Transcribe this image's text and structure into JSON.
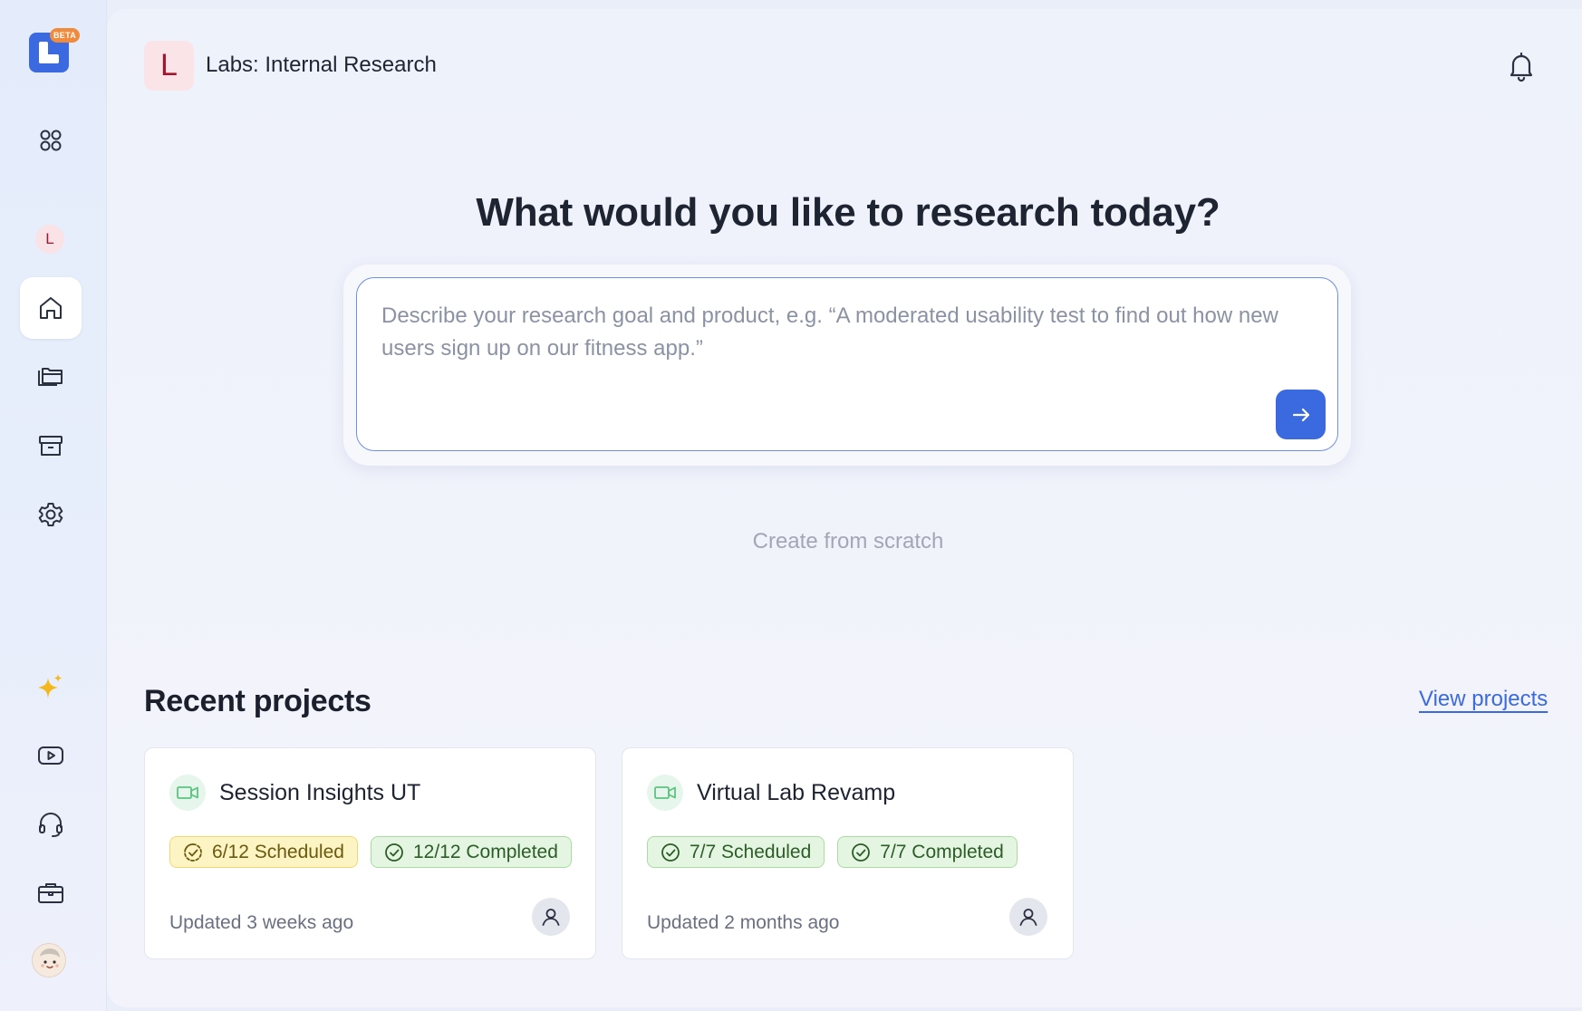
{
  "sidebar": {
    "logo_badge": "BETA",
    "workspace_initial": "L",
    "icons": {
      "apps": "apps-grid-icon",
      "home": "home-icon",
      "projects": "folders-icon",
      "archive": "archive-icon",
      "settings": "gear-icon",
      "ai": "sparkles-icon",
      "tutorials": "play-video-icon",
      "support": "headset-icon",
      "marketplace": "briefcase-icon"
    },
    "active_item": "home"
  },
  "header": {
    "workspace_initial": "L",
    "workspace_name": "Labs: Internal Research"
  },
  "hero": {
    "headline": "What would you like to research today?",
    "prompt_placeholder": "Describe your research goal and product, e.g. “A moderated usability test to find out how new users sign up on our fitness app.”",
    "create_from_scratch": "Create from scratch"
  },
  "recent": {
    "title": "Recent projects",
    "view_all": "View projects",
    "projects": [
      {
        "name": "Session Insights UT",
        "scheduled": "6/12 Scheduled",
        "completed": "12/12 Completed",
        "updated": "Updated 3 weeks ago",
        "scheduled_state": "partial"
      },
      {
        "name": "Virtual Lab Revamp",
        "scheduled": "7/7 Scheduled",
        "completed": "7/7 Completed",
        "updated": "Updated 2 months ago",
        "scheduled_state": "complete"
      }
    ]
  },
  "colors": {
    "accent": "#3b6ae0",
    "workspace_badge_bg": "#fbe4e8",
    "workspace_badge_fg": "#a5142c",
    "chip_yellow_bg": "#fdf4c4",
    "chip_green_bg": "#e4f6e1"
  }
}
